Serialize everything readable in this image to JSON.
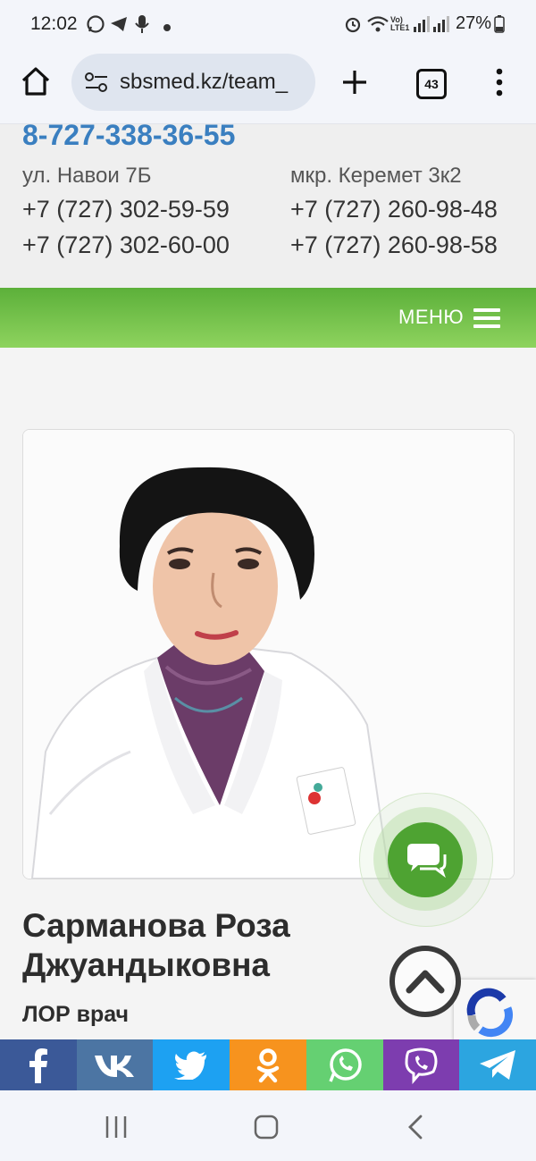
{
  "status_bar": {
    "time": "12:02",
    "battery": "27%",
    "icons": [
      "whatsapp-icon",
      "telegram-icon",
      "mic-icon",
      "dot-icon",
      "alarm-icon",
      "wifi-icon",
      "volte-icon",
      "signal-icon",
      "signal-icon",
      "battery-icon"
    ]
  },
  "browser": {
    "url": "sbsmed.kz/team_",
    "tab_count": "43",
    "icons": [
      "home-icon",
      "site-settings-icon",
      "new-tab-icon",
      "tabs-icon",
      "more-icon"
    ]
  },
  "contacts": {
    "main_phone": "8-727-338-36-55",
    "branches": [
      {
        "address": "ул. Навои 7Б",
        "phones": [
          "+7 (727) 302-59-59",
          "+7 (727) 302-60-00"
        ]
      },
      {
        "address": "мкр. Керемет 3к2",
        "phones": [
          "+7 (727) 260-98-48",
          "+7 (727) 260-98-58"
        ]
      }
    ]
  },
  "menu": {
    "label": "МЕНЮ",
    "icon": "hamburger-icon"
  },
  "doctor": {
    "name_line1": "Сарманова Роза",
    "name_line2": "Джуандыковна",
    "role": "ЛОР врач",
    "photo": "doctor-photo"
  },
  "share": [
    {
      "name": "facebook",
      "label": "f",
      "color": "#3b5998"
    },
    {
      "name": "vk",
      "label": "VK",
      "color": "#4c75a3"
    },
    {
      "name": "twitter",
      "label": "twitter",
      "color": "#1da1f2"
    },
    {
      "name": "odnoklassniki",
      "label": "ok",
      "color": "#f7931e"
    },
    {
      "name": "whatsapp",
      "label": "whatsapp",
      "color": "#65d072"
    },
    {
      "name": "viber",
      "label": "viber",
      "color": "#7d3daf"
    },
    {
      "name": "telegram",
      "label": "telegram",
      "color": "#2ca5e0"
    }
  ],
  "colors": {
    "accent_blue": "#3a7fc0",
    "menu_green": "#5cb03a",
    "chat_green": "#4ea332"
  }
}
